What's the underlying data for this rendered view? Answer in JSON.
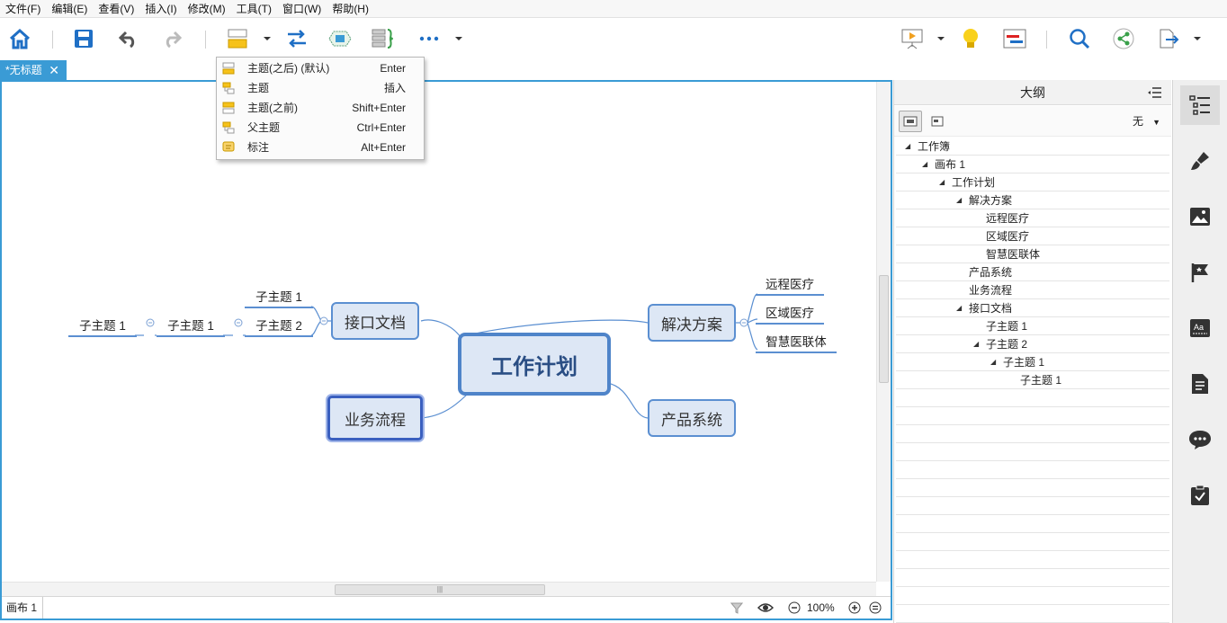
{
  "menu": [
    "文件(F)",
    "编辑(E)",
    "查看(V)",
    "插入(I)",
    "修改(M)",
    "工具(T)",
    "窗口(W)",
    "帮助(H)"
  ],
  "tab": {
    "title": "*无标题",
    "close": "✕"
  },
  "context_menu": [
    {
      "label": "主题(之后) (默认)",
      "key": "Enter"
    },
    {
      "label": "主题",
      "key": "插入"
    },
    {
      "label": "主题(之前)",
      "key": "Shift+Enter"
    },
    {
      "label": "父主题",
      "key": "Ctrl+Enter"
    },
    {
      "label": "标注",
      "key": "Alt+Enter"
    }
  ],
  "map": {
    "central": "工作计划",
    "right_top": "解决方案",
    "right_top_subs": [
      "远程医疗",
      "区域医疗",
      "智慧医联体"
    ],
    "right_bottom": "产品系统",
    "left_top": "接口文档",
    "left_top_subs": [
      "子主题 1",
      "子主题 2"
    ],
    "left_deep": [
      "子主题 1",
      "子主题 1"
    ],
    "left_bottom": "业务流程"
  },
  "status": {
    "sheet": "画布 1",
    "zoom": "100%"
  },
  "outline": {
    "title": "大纲",
    "filter": "无",
    "rows": [
      {
        "text": "工作簿",
        "level": 0,
        "expanded": true
      },
      {
        "text": "画布 1",
        "level": 1,
        "expanded": true
      },
      {
        "text": "工作计划",
        "level": 2,
        "expanded": true
      },
      {
        "text": "解决方案",
        "level": 3,
        "expanded": true
      },
      {
        "text": "远程医疗",
        "level": 4,
        "expanded": false
      },
      {
        "text": "区域医疗",
        "level": 4,
        "expanded": false
      },
      {
        "text": "智慧医联体",
        "level": 4,
        "expanded": false
      },
      {
        "text": "产品系统",
        "level": 3,
        "expanded": false
      },
      {
        "text": "业务流程",
        "level": 3,
        "expanded": false
      },
      {
        "text": "接口文档",
        "level": 3,
        "expanded": true
      },
      {
        "text": "子主题 1",
        "level": 4,
        "expanded": false
      },
      {
        "text": "子主题 2",
        "level": 4,
        "expanded": true
      },
      {
        "text": "子主题 1",
        "level": 5,
        "expanded": true
      },
      {
        "text": "子主题 1",
        "level": 6,
        "expanded": false
      }
    ]
  },
  "colors": {
    "accent": "#3a9bd5",
    "node_border": "#5b8fd1",
    "node_fill": "#dde7f5"
  }
}
